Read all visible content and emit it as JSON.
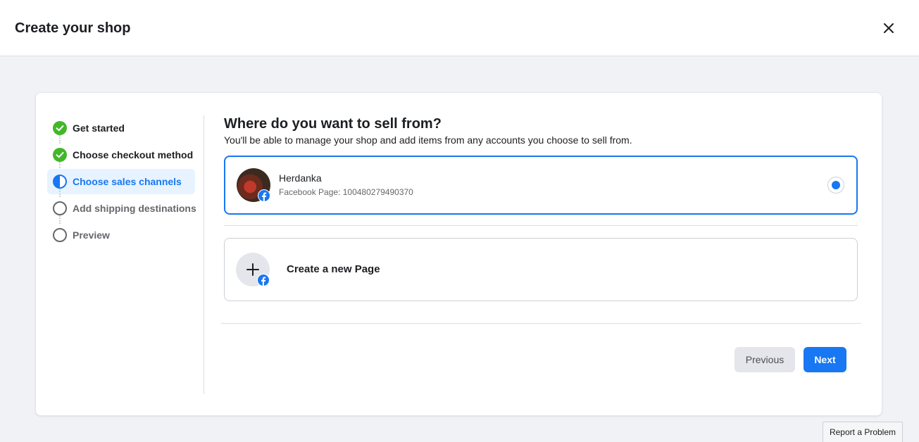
{
  "header": {
    "title": "Create your shop",
    "close_icon": "close-icon"
  },
  "steps": [
    {
      "label": "Get started",
      "state": "complete",
      "icon": "check-circle-icon"
    },
    {
      "label": "Choose checkout method",
      "state": "complete",
      "icon": "check-circle-icon"
    },
    {
      "label": "Choose sales channels",
      "state": "active",
      "icon": "half-circle-icon"
    },
    {
      "label": "Add shipping destinations",
      "state": "pending",
      "icon": "empty-circle-icon"
    },
    {
      "label": "Preview",
      "state": "pending",
      "icon": "empty-circle-icon"
    }
  ],
  "main": {
    "title": "Where do you want to sell from?",
    "subtitle": "You'll be able to manage your shop and add items from any accounts you choose to sell from.",
    "selected_option": {
      "name": "Herdanka",
      "meta": "Facebook Page: 100480279490370",
      "selected": true
    },
    "create_option": {
      "label": "Create a new Page"
    }
  },
  "buttons": {
    "previous": "Previous",
    "next": "Next"
  },
  "report": "Report a Problem",
  "colors": {
    "accent": "#1877f2",
    "success": "#42b72a",
    "background": "#f0f2f5",
    "active_step_bg": "#e7f3ff"
  }
}
